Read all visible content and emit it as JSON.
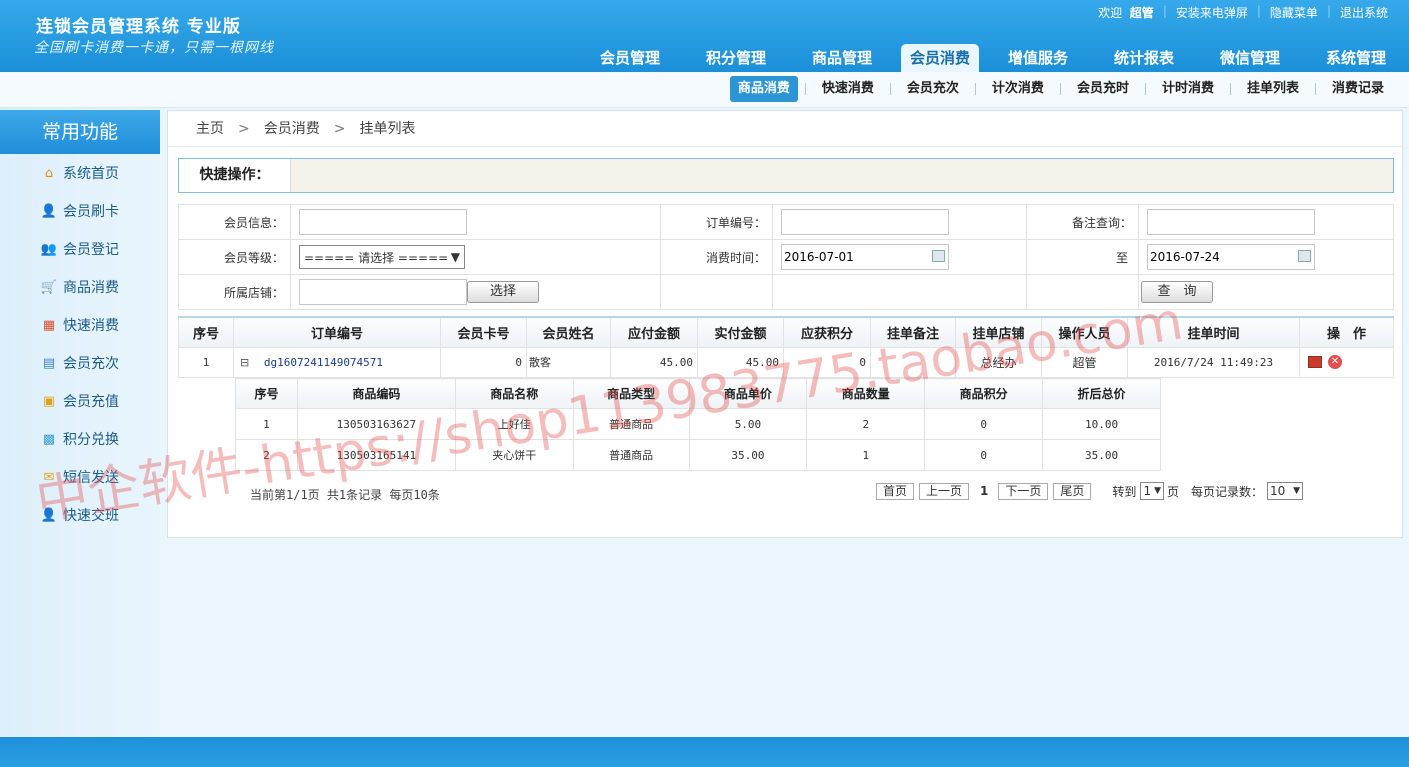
{
  "header": {
    "title": "连锁会员管理系统 专业版",
    "slogan": "全国刷卡消费一卡通，只需一根网线",
    "welcome": "欢迎",
    "user": "超管",
    "links": [
      "安装来电弹屏",
      "隐藏菜单",
      "退出系统"
    ],
    "main_tabs": [
      "会员管理",
      "积分管理",
      "商品管理",
      "会员消费",
      "增值服务",
      "统计报表",
      "微信管理",
      "系统管理"
    ],
    "active_main_tab": "会员消费"
  },
  "subnav": {
    "items": [
      "商品消费",
      "快速消费",
      "会员充次",
      "计次消费",
      "会员充时",
      "计时消费",
      "挂单列表",
      "消费记录"
    ],
    "active": "商品消费"
  },
  "sidebar": {
    "title": "常用功能",
    "items": [
      {
        "label": "系统首页",
        "icon": "home-icon",
        "glyph": "⌂",
        "color": "#e08a1e"
      },
      {
        "label": "会员刷卡",
        "icon": "member-card-icon",
        "glyph": "👤",
        "color": "#3a82c4"
      },
      {
        "label": "会员登记",
        "icon": "member-register-icon",
        "glyph": "👥",
        "color": "#3a82c4"
      },
      {
        "label": "商品消费",
        "icon": "cart-icon",
        "glyph": "🛒",
        "color": "#e08a1e"
      },
      {
        "label": "快速消费",
        "icon": "chart-icon",
        "glyph": "▦",
        "color": "#d8502c"
      },
      {
        "label": "会员充次",
        "icon": "register-icon",
        "glyph": "▤",
        "color": "#3a82c4"
      },
      {
        "label": "会员充值",
        "icon": "recharge-icon",
        "glyph": "▣",
        "color": "#e0a21e"
      },
      {
        "label": "积分兑换",
        "icon": "exchange-icon",
        "glyph": "▩",
        "color": "#3a9ed6"
      },
      {
        "label": "短信发送",
        "icon": "mail-icon",
        "glyph": "✉",
        "color": "#e0a21e"
      },
      {
        "label": "快速交班",
        "icon": "shift-icon",
        "glyph": "👤",
        "color": "#3a82c4"
      }
    ]
  },
  "breadcrumb": [
    "主页",
    "会员消费",
    "挂单列表"
  ],
  "quick_ops": {
    "label": "快捷操作："
  },
  "search": {
    "member_info_label": "会员信息：",
    "member_info_value": "",
    "order_no_label": "订单编号：",
    "order_no_value": "",
    "remark_label": "备注查询：",
    "remark_value": "",
    "level_label": "会员等级：",
    "level_value": "===== 请选择 =====",
    "time_label": "消费时间：",
    "time_from": "2016-07-01",
    "to_label": "至",
    "time_to": "2016-07-24",
    "store_label": "所属店铺：",
    "store_value": "",
    "choose_button": "选择",
    "query_button": "查　询"
  },
  "list": {
    "headers": [
      "序号",
      "订单编号",
      "会员卡号",
      "会员姓名",
      "应付金额",
      "实付金额",
      "应获积分",
      "挂单备注",
      "挂单店铺",
      "操作人员",
      "挂单时间",
      "操　作"
    ],
    "rows": [
      {
        "index": "1",
        "toggle": "⊟",
        "order_no": "dg1607241149074571",
        "card_no": "0",
        "name": "散客",
        "payable": "45.00",
        "paid": "45.00",
        "points": "0",
        "remark": "",
        "store": "总经办",
        "operator": "超管",
        "time": "2016/7/24 11:49:23"
      }
    ]
  },
  "sub_list": {
    "headers": [
      "序号",
      "商品编码",
      "商品名称",
      "商品类型",
      "商品单价",
      "商品数量",
      "商品积分",
      "折后总价"
    ],
    "rows": [
      {
        "index": "1",
        "code": "130503163627",
        "name": "上好佳",
        "type": "普通商品",
        "price": "5.00",
        "qty": "2",
        "points": "0",
        "total": "10.00"
      },
      {
        "index": "2",
        "code": "130503165141",
        "name": "夹心饼干",
        "type": "普通商品",
        "price": "35.00",
        "qty": "1",
        "points": "0",
        "total": "35.00"
      }
    ]
  },
  "pagination": {
    "info": "当前第1/1页  共1条记录  每页10条",
    "first": "首页",
    "prev": "上一页",
    "current": "1",
    "next": "下一页",
    "last": "尾页",
    "goto_label": "转到",
    "goto_value": "1",
    "page_unit": "页",
    "per_page_label": "每页记录数：",
    "per_page_value": "10"
  },
  "watermark": "中企软件-https://shop113983775.taobao.com"
}
